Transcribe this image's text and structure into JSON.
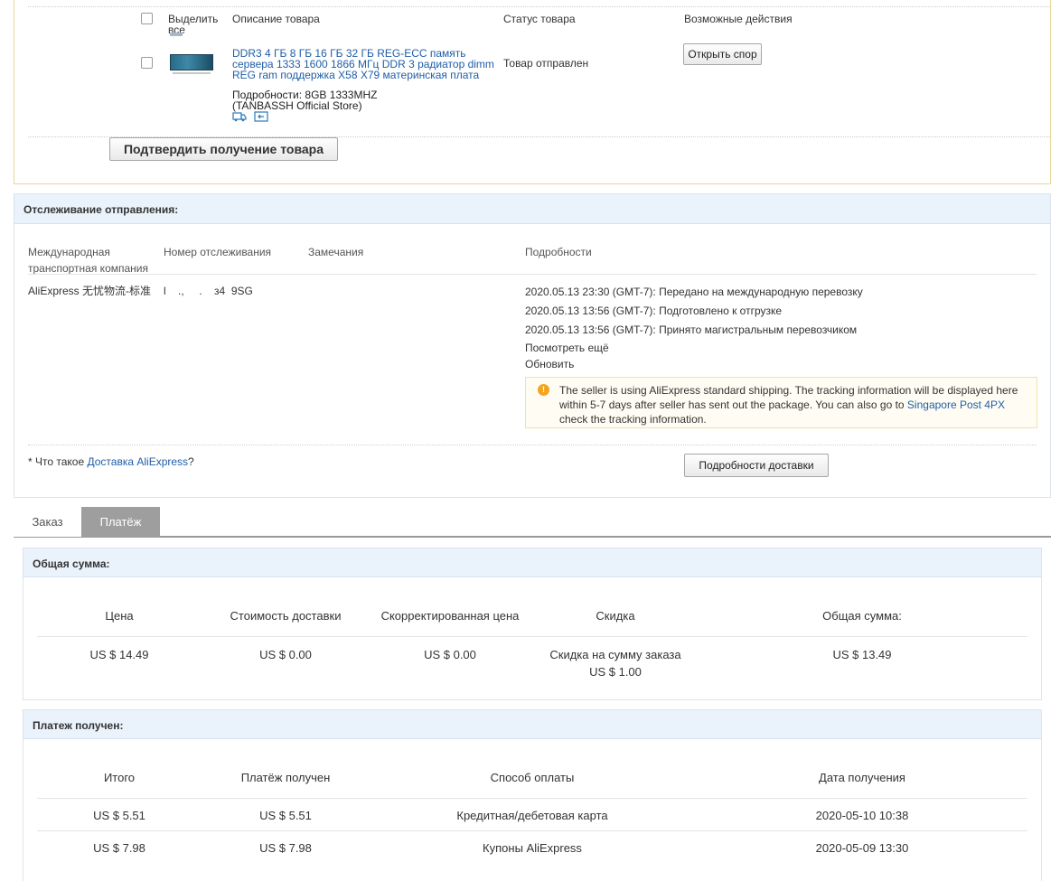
{
  "order": {
    "select_all": "Выделить все",
    "col_description": "Описание товара",
    "col_status": "Статус товара",
    "col_actions": "Возможные действия",
    "product_title": "DDR3 4 ГБ 8 ГБ 16 ГБ 32 ГБ REG-ECC память сервера 1333 1600 1866 МГц DDR 3 радиатор dimm REG ram поддержка X58 X79 материнская плата",
    "product_details": "Подробности: 8GB 1333MHZ",
    "store_name": "(TANBASSH Official Store)",
    "status": "Товар отправлен",
    "dispute_button": "Открыть спор",
    "confirm_button": "Подтвердить получение товара",
    "icons": [
      "truck-icon",
      "return-icon"
    ]
  },
  "tracking": {
    "title": "Отслеживание отправления:",
    "col_carrier": "Международная транспортная компания",
    "col_number": "Номер отслеживания",
    "col_notes": "Замечания",
    "col_details": "Подробности",
    "carrier": "AliExpress 无忧物流-标准",
    "number": "l    .,     .    з4  9SG",
    "events": [
      "2020.05.13 23:30 (GMT-7): Передано на международную перевозку",
      "2020.05.13 13:56 (GMT-7): Подготовлено к отгрузке",
      "2020.05.13 13:56 (GMT-7): Принято магистральным перевозчиком"
    ],
    "see_more": "Посмотреть ещё",
    "refresh": "Обновить",
    "notice_part1": "The seller is using AliExpress standard shipping. The tracking information will be displayed here within 5-7 days after seller has sent out the package. You can also go to ",
    "notice_link": "Singapore Post 4PX",
    "notice_part2": "check the tracking information.",
    "footnote_prefix": "* Что такое ",
    "footnote_link": "Доставка AliExpress",
    "footnote_suffix": "?",
    "delivery_button": "Подробности доставки"
  },
  "tabs": {
    "order": "Заказ",
    "payment": "Платёж"
  },
  "total": {
    "title": "Общая сумма:",
    "headers": [
      "Цена",
      "Стоимость доставки",
      "Скорректированная цена",
      "Скидка",
      "Общая сумма:"
    ],
    "price": "US $ 14.49",
    "shipping": "US $ 0.00",
    "adjusted": "US $ 0.00",
    "discount_label": "Скидка на сумму заказа",
    "discount_value": "US $ 1.00",
    "sum": "US $ 13.49"
  },
  "payment": {
    "title": "Платеж получен:",
    "headers": [
      "Итого",
      "Платёж получен",
      "Способ оплаты",
      "Дата получения"
    ],
    "rows": [
      [
        "US $ 5.51",
        "US $ 5.51",
        "Кредитная/дебетовая карта",
        "2020-05-10 10:38"
      ],
      [
        "US $ 7.98",
        "US $ 7.98",
        "Купоны AliExpress",
        "2020-05-09 13:30"
      ]
    ]
  },
  "colors": {
    "link": "#1f5ea8",
    "panel_header_bg": "#eaf2fb",
    "tab_active_bg": "#9e9e9e",
    "order_border": "#e8d89a",
    "notice_icon": "#f4a51e"
  }
}
